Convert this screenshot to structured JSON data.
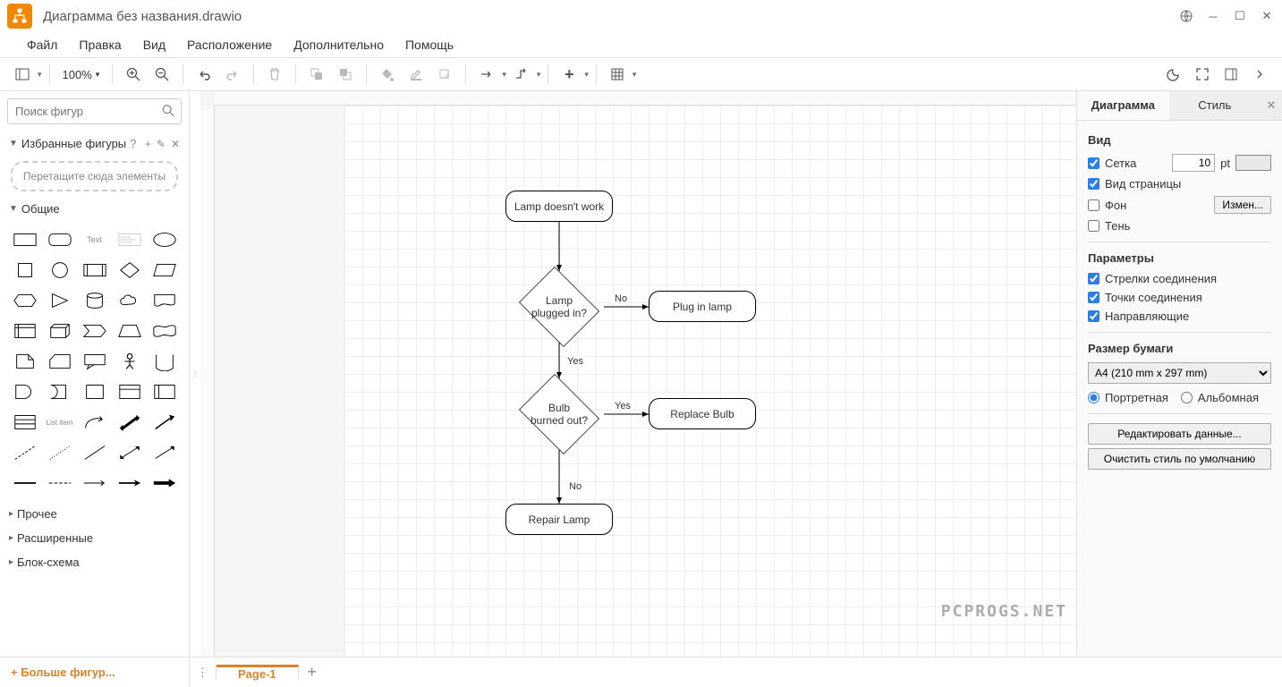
{
  "title": "Диаграмма без названия.drawio",
  "menu": [
    "Файл",
    "Правка",
    "Вид",
    "Расположение",
    "Дополнительно",
    "Помощь"
  ],
  "zoom": "100%",
  "search_placeholder": "Поиск фигур",
  "sidebar": {
    "favorites": "Избранные фигуры",
    "favorites_hint": "?",
    "dropzone": "Перетащите сюда элементы",
    "common": "Общие",
    "misc": "Прочее",
    "advanced": "Расширенные",
    "flowchart": "Блок-схема",
    "more": "+ Больше фигур..."
  },
  "diagram": {
    "nodes": {
      "start": "Lamp doesn't work",
      "plugged": "Lamp\nplugged in?",
      "plugin": "Plug in lamp",
      "burned": "Bulb\nburned out?",
      "replace": "Replace Bulb",
      "repair": "Repair Lamp"
    },
    "labels": {
      "no1": "No",
      "yes1": "Yes",
      "yes2": "Yes",
      "no2": "No"
    }
  },
  "right": {
    "tabs": {
      "diagram": "Диаграмма",
      "style": "Стиль"
    },
    "view": "Вид",
    "grid": "Сетка",
    "grid_val": "10",
    "grid_unit": "pt",
    "pageview": "Вид страницы",
    "background": "Фон",
    "change": "Измен...",
    "shadow": "Тень",
    "params": "Параметры",
    "conn_arrows": "Стрелки соединения",
    "conn_points": "Точки соединения",
    "guides": "Направляющие",
    "paper": "Размер бумаги",
    "paper_val": "A4 (210 mm x 297 mm)",
    "portrait": "Портретная",
    "landscape": "Альбомная",
    "edit_data": "Редактировать данные...",
    "clear_style": "Очистить стиль по умолчанию"
  },
  "page_tab": "Page-1",
  "watermark": "PCPROGS.NET"
}
